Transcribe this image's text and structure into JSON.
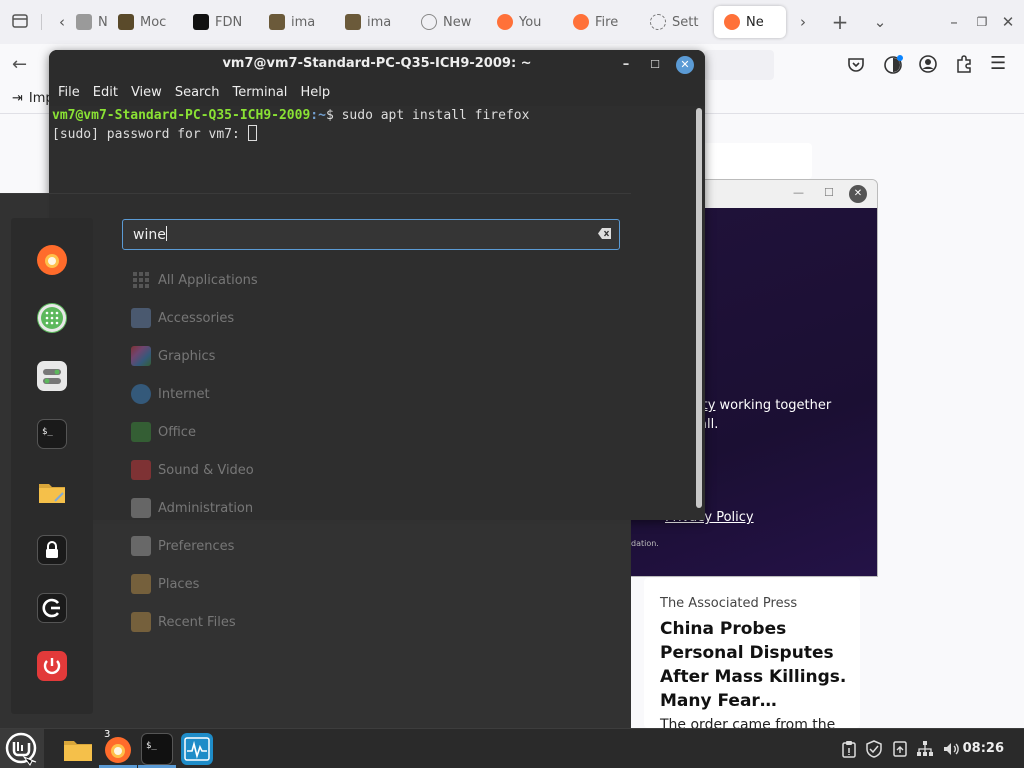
{
  "browser": {
    "tabs": [
      {
        "label": "N",
        "color": "#9a9a9a"
      },
      {
        "label": "Moc",
        "color": "#5a4a2a"
      },
      {
        "label": "FDN",
        "color": "#111111"
      },
      {
        "label": "ima",
        "color": "#6b5a3a"
      },
      {
        "label": "ima",
        "color": "#6b5a3a"
      },
      {
        "label": "New",
        "color": "#9a9a9a"
      },
      {
        "label": "You",
        "color": "#ff7139"
      },
      {
        "label": "Fire",
        "color": "#ff7139"
      },
      {
        "label": "Sett",
        "color": "#7a7a7a"
      },
      {
        "label": "Ne",
        "color": "#ff7139"
      }
    ],
    "bookmark_label": "Imp",
    "popup": {
      "text_line1_link": "ity",
      "text_line1": " working together",
      "text_line2": "all.",
      "privacy_link": "Privacy Policy",
      "footer_fragment": "dation."
    },
    "news": {
      "source": "The Associated Press",
      "headline": "China Probes Personal Disputes After Mass Killings. Many Fear…",
      "snippet": "The order came from the top. China's leader Xi Jinping"
    }
  },
  "terminal": {
    "title": "vm7@vm7-Standard-PC-Q35-ICH9-2009: ~",
    "menu": [
      "File",
      "Edit",
      "View",
      "Search",
      "Terminal",
      "Help"
    ],
    "prompt_user": "vm7@vm7-Standard-PC-Q35-ICH9-2009",
    "prompt_path": ":~",
    "prompt_symbol": "$ ",
    "command": "sudo apt install firefox",
    "password_prompt": "[sudo] password for vm7: "
  },
  "menu": {
    "search_value": "wine",
    "categories": [
      {
        "label": "All Applications",
        "icon": "grid-icon",
        "color": "#888888"
      },
      {
        "label": "Accessories",
        "icon": "scissors-icon",
        "color": "#6c8ebf"
      },
      {
        "label": "Graphics",
        "icon": "palette-icon",
        "color": "#c060c0"
      },
      {
        "label": "Internet",
        "icon": "globe-icon",
        "color": "#3c8ed8"
      },
      {
        "label": "Office",
        "icon": "document-icon",
        "color": "#3c9a3c"
      },
      {
        "label": "Sound & Video",
        "icon": "play-icon",
        "color": "#e0383c"
      },
      {
        "label": "Administration",
        "icon": "toggle-icon",
        "color": "#aaaaaa"
      },
      {
        "label": "Preferences",
        "icon": "settings-icon",
        "color": "#aaaaaa"
      },
      {
        "label": "Places",
        "icon": "folder-icon",
        "color": "#c89a4a"
      },
      {
        "label": "Recent Files",
        "icon": "recent-folder-icon",
        "color": "#c89a4a"
      }
    ],
    "favorites": [
      {
        "name": "firefox-icon",
        "color": "#ff6b2b"
      },
      {
        "name": "software-manager-icon",
        "color": "#5cb85c"
      },
      {
        "name": "system-settings-icon",
        "color": "#e8e8e8"
      },
      {
        "name": "terminal-icon",
        "color": "#1a1a1a"
      },
      {
        "name": "files-icon",
        "color": "#f5c04a"
      },
      {
        "name": "lock-screen-icon",
        "color": "#1a1a1a"
      },
      {
        "name": "logout-icon",
        "color": "#1a1a1a"
      },
      {
        "name": "shutdown-icon",
        "color": "#e23a3a"
      }
    ]
  },
  "taskbar": {
    "firefox_badge": "3",
    "clock": "08:26"
  }
}
